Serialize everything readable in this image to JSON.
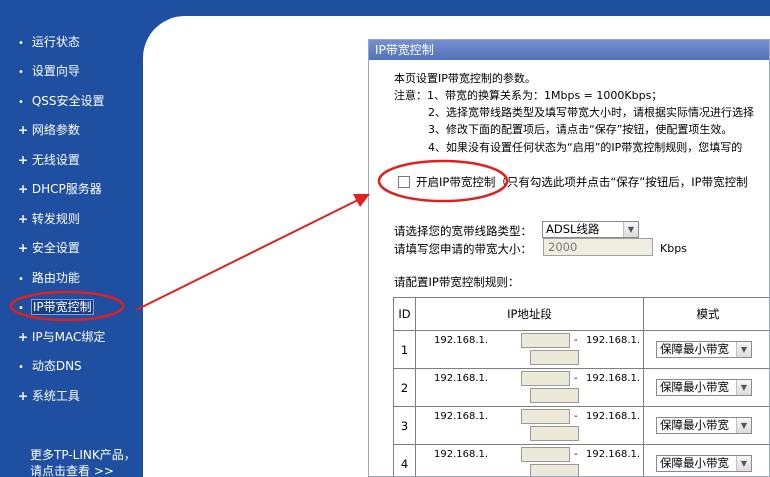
{
  "sidebar": {
    "items": [
      {
        "label": "运行状态",
        "marker": "•"
      },
      {
        "label": "设置向导",
        "marker": "•"
      },
      {
        "label": "QSS安全设置",
        "marker": "•"
      },
      {
        "label": "网络参数",
        "marker": "+"
      },
      {
        "label": "无线设置",
        "marker": "+"
      },
      {
        "label": "DHCP服务器",
        "marker": "+"
      },
      {
        "label": "转发规则",
        "marker": "+"
      },
      {
        "label": "安全设置",
        "marker": "+"
      },
      {
        "label": "路由功能",
        "marker": "•"
      },
      {
        "label": "IP带宽控制",
        "marker": "•"
      },
      {
        "label": "IP与MAC绑定",
        "marker": "+"
      },
      {
        "label": "动态DNS",
        "marker": "•"
      },
      {
        "label": "系统工具",
        "marker": "+"
      }
    ],
    "more_line1": "更多TP-LINK产品，",
    "more_line2": "请点击查看 >>"
  },
  "panel": {
    "title": "IP带宽控制",
    "intro": "本页设置IP带宽控制的参数。",
    "notes": [
      "注意：1、带宽的换算关系为：1Mbps = 1000Kbps；",
      "2、选择宽带线路类型及填写带宽大小时，请根据实际情况进行选择",
      "3、修改下面的配置项后，请点击“保存”按钮，使配置项生效。",
      "4、如果没有设置任何状态为“启用”的IP带宽控制规则，您填写的"
    ],
    "enable_label": "开启IP带宽控制",
    "enable_hint": "（只有勾选此项并点击“保存”按钮后，IP带宽控制",
    "line_type_label": "请选择您的宽带线路类型：",
    "line_type_value": "ADSL线路",
    "bandwidth_label": "请填写您申请的带宽大小：",
    "bandwidth_value": "2000",
    "bandwidth_unit": "Kbps",
    "rules_label": "请配置IP带宽控制规则：",
    "table": {
      "headers": [
        "ID",
        "IP地址段",
        "模式"
      ],
      "rows": [
        {
          "id": "1",
          "ip_prefix": "192.168.1.",
          "dash": "-",
          "ip_prefix2": "192.168.1.",
          "mode": "保障最小带宽"
        },
        {
          "id": "2",
          "ip_prefix": "192.168.1.",
          "dash": "-",
          "ip_prefix2": "192.168.1.",
          "mode": "保障最小带宽"
        },
        {
          "id": "3",
          "ip_prefix": "192.168.1.",
          "dash": "-",
          "ip_prefix2": "192.168.1.",
          "mode": "保障最小带宽"
        },
        {
          "id": "4",
          "ip_prefix": "192.168.1.",
          "dash": "-",
          "ip_prefix2": "192.168.1.",
          "mode": "保障最小带宽"
        }
      ]
    }
  },
  "colors": {
    "sidebar_bg": "#1f4fa0",
    "title_bar": "#6282c4",
    "annotation": "#e02020"
  }
}
